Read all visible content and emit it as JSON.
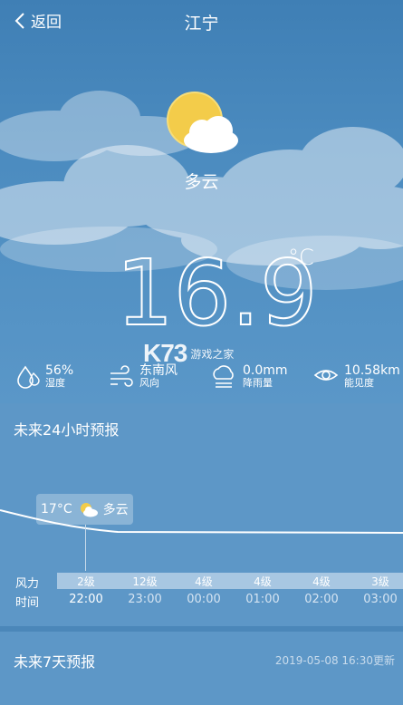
{
  "header": {
    "back_label": "返回",
    "city": "江宁"
  },
  "current": {
    "condition": "多云",
    "temperature": "16.9",
    "unit": "°C"
  },
  "watermark": {
    "logo": "K73",
    "text": "游戏之家"
  },
  "stats": [
    {
      "value": "56%",
      "label": "湿度",
      "icon": "humidity-icon"
    },
    {
      "value": "东南风",
      "label": "风向",
      "icon": "wind-icon"
    },
    {
      "value": "0.0mm",
      "label": "降雨量",
      "icon": "rain-icon"
    },
    {
      "value": "10.58km",
      "label": "能见度",
      "icon": "visibility-icon"
    }
  ],
  "hourly": {
    "title": "未来24小时预报",
    "tooltip": {
      "temp": "17°C",
      "condition": "多云"
    },
    "wind_label": "风力",
    "time_label": "时间",
    "wind": [
      "2级",
      "12级",
      "4级",
      "4级",
      "4级",
      "3级"
    ],
    "times": [
      "22:00",
      "23:00",
      "00:00",
      "01:00",
      "02:00",
      "03:00"
    ]
  },
  "weekly": {
    "title": "未来7天预报",
    "updated": "2019-05-08 16:30更新"
  },
  "colors": {
    "sky": "#4b87b9",
    "panel": "#5d97c7",
    "wind_band": "#a8c7e2",
    "sun": "#f3cc4a"
  }
}
